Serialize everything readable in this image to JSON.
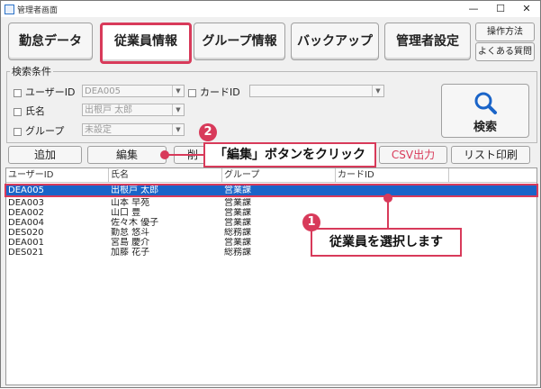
{
  "window": {
    "title": "管理者画面",
    "min": "—",
    "max": "☐",
    "close": "✕"
  },
  "toolbar": {
    "buttons": [
      "勤怠データ",
      "従業員情報",
      "グループ情報",
      "バックアップ",
      "管理者設定"
    ],
    "active": "従業員情報",
    "side_buttons": [
      "操作方法",
      "よくある質問"
    ]
  },
  "search": {
    "group_label": "検索条件",
    "user_id_label": "ユーザーID",
    "user_id_value": "DEA005",
    "card_id_label": "カードID",
    "card_id_value": "",
    "name_label": "氏名",
    "name_value": "出根戸 太郎",
    "group_label_field": "グループ",
    "group_value": "未設定",
    "search_button": "検索"
  },
  "actions": {
    "add": "追加",
    "edit": "編集",
    "delete_partial": "削",
    "csv": "CSV出力",
    "print": "リスト印刷"
  },
  "table": {
    "headers": [
      "ユーザーID",
      "氏名",
      "グループ",
      "カードID"
    ],
    "rows": [
      [
        "DEA005",
        "出根戸 太郎",
        "営業課",
        ""
      ],
      [
        "DEA003",
        "山本 早苑",
        "営業課",
        ""
      ],
      [
        "DEA002",
        "山口 豊",
        "営業課",
        ""
      ],
      [
        "DEA004",
        "佐々木 優子",
        "営業課",
        ""
      ],
      [
        "DES020",
        "勤怠 悠斗",
        "総務課",
        ""
      ],
      [
        "DEA001",
        "宮島 慶介",
        "営業課",
        ""
      ],
      [
        "DES021",
        "加藤 花子",
        "総務課",
        ""
      ]
    ],
    "selected_index": 0
  },
  "annotations": {
    "step1_number": "1",
    "step1_text": "従業員を選択します",
    "step2_number": "2",
    "step2_text": "「編集」ボタンをクリック",
    "accent": "#d83a5a"
  }
}
